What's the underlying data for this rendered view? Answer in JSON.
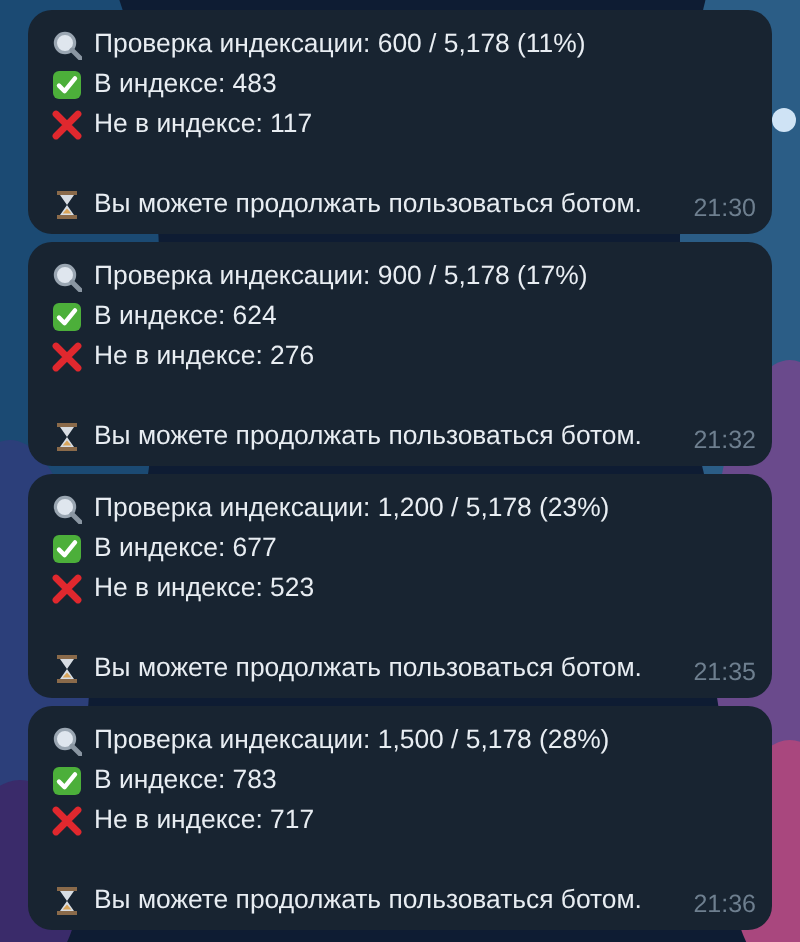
{
  "messages": [
    {
      "lines": [
        {
          "kind": "search",
          "text": "Проверка индексации: 600 / 5,178 (11%)"
        },
        {
          "kind": "check",
          "text": "В индексе: 483"
        },
        {
          "kind": "cross",
          "text": "Не в индексе: 117"
        }
      ],
      "note": {
        "kind": "hourglass",
        "text": "Вы можете продолжать пользоваться ботом."
      },
      "time": "21:30"
    },
    {
      "lines": [
        {
          "kind": "search",
          "text": "Проверка индексации: 900 / 5,178 (17%)"
        },
        {
          "kind": "check",
          "text": "В индексе: 624"
        },
        {
          "kind": "cross",
          "text": "Не в индексе: 276"
        }
      ],
      "note": {
        "kind": "hourglass",
        "text": "Вы можете продолжать пользоваться ботом."
      },
      "time": "21:32"
    },
    {
      "lines": [
        {
          "kind": "search",
          "text": "Проверка индексации: 1,200 / 5,178 (23%)"
        },
        {
          "kind": "check",
          "text": "В индексе: 677"
        },
        {
          "kind": "cross",
          "text": "Не в индексе: 523"
        }
      ],
      "note": {
        "kind": "hourglass",
        "text": "Вы можете продолжать пользоваться ботом."
      },
      "time": "21:35"
    },
    {
      "lines": [
        {
          "kind": "search",
          "text": "Проверка индексации: 1,500 / 5,178 (28%)"
        },
        {
          "kind": "check",
          "text": "В индексе: 783"
        },
        {
          "kind": "cross",
          "text": "Не в индексе: 717"
        }
      ],
      "note": {
        "kind": "hourglass",
        "text": "Вы можете продолжать пользоваться ботом."
      },
      "time": "21:36"
    }
  ]
}
